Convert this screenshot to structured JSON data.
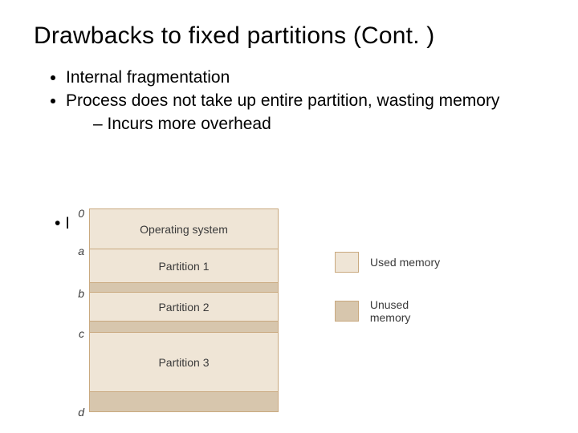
{
  "title": "Drawbacks to fixed partitions (Cont. )",
  "bullets": {
    "b1": "Internal fragmentation",
    "b2": "Process does not take up entire partition, wasting memory",
    "b2_sub1": "Incurs more overhead"
  },
  "memory": {
    "ticks": {
      "t0": "0",
      "ta": "a",
      "tb": "b",
      "tc": "c",
      "td": "d"
    },
    "segments": {
      "os": "Operating system",
      "p1": "Partition 1",
      "gap1": "",
      "p2": "Partition 2",
      "gap2": "",
      "p3": "Partition 3",
      "gap3": ""
    }
  },
  "legend": {
    "used": "Used memory",
    "unused": "Unused memory"
  }
}
